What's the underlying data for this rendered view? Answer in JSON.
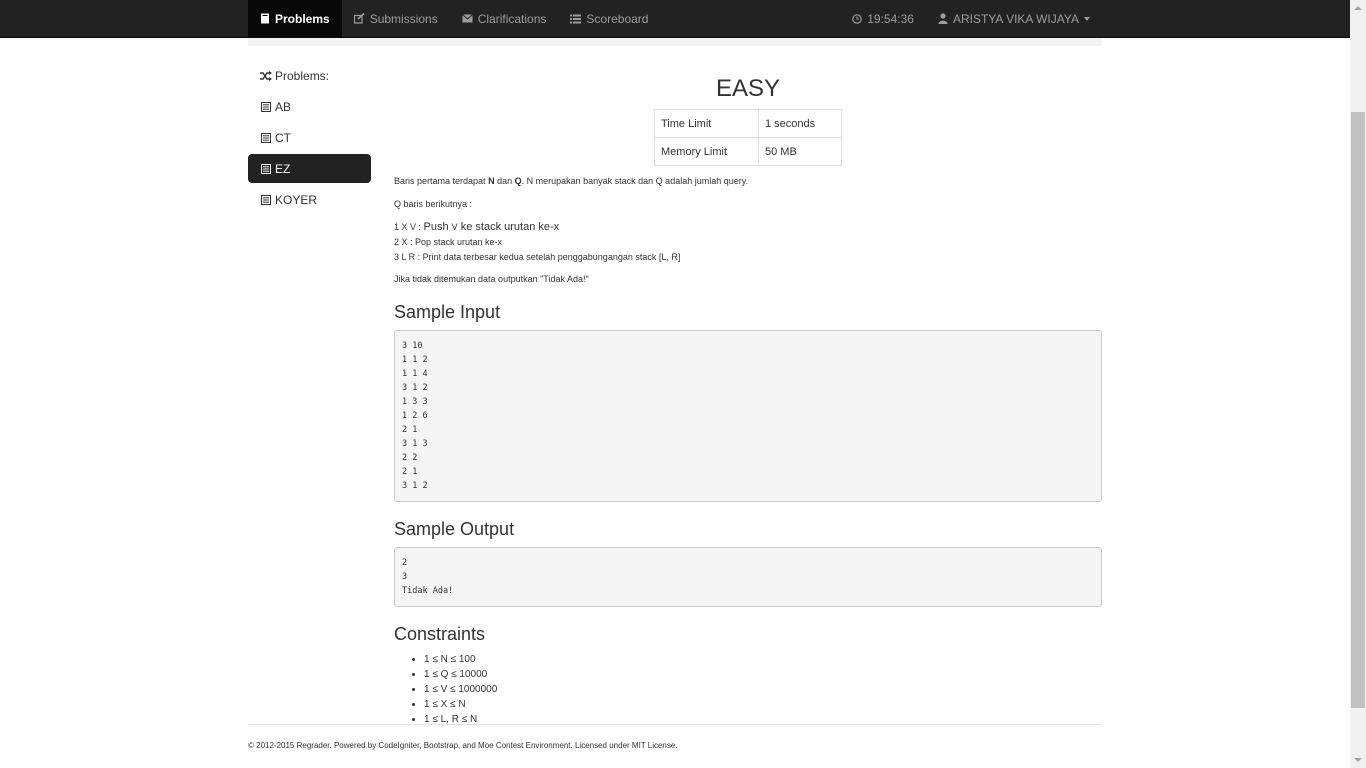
{
  "navbar": {
    "items": [
      {
        "label": "Problems",
        "icon": "book-icon",
        "active": true
      },
      {
        "label": "Submissions",
        "icon": "edit-icon",
        "active": false
      },
      {
        "label": "Clarifications",
        "icon": "envelope-icon",
        "active": false
      },
      {
        "label": "Scoreboard",
        "icon": "list-icon",
        "active": false
      }
    ],
    "clock": "19:54:36",
    "user": "ARISTYA VIKA WIJAYA"
  },
  "sidebar": {
    "header": "Problems:",
    "items": [
      {
        "label": "AB"
      },
      {
        "label": "CT"
      },
      {
        "label": "EZ",
        "active": true
      },
      {
        "label": "KOYER"
      }
    ]
  },
  "problem": {
    "title": "EASY",
    "limits": [
      {
        "label": "Time Limit",
        "value": "1 seconds"
      },
      {
        "label": "Memory Limit",
        "value": "50 MB"
      }
    ],
    "desc1": {
      "pre": "Baris pertama terdapat ",
      "n": "N",
      "mid": " dan ",
      "q": "Q",
      "post": ". N merupakan banyak stack dan Q adalah jumlah query."
    },
    "desc2": "Q baris berikutnya :",
    "query1": {
      "a": "1 X V  : ",
      "b": "Push ",
      "c": "V",
      "d": " ke stack urutan ke-",
      "e": "x"
    },
    "query2": "2 X     : Pop stack urutan ke-x",
    "query3": "3 L R  : Print data terbesar kedua setelah penggabungangan stack [L, R]",
    "desc3": "Jika tidak ditemukan data outputkan \"Tidak Ada!\"",
    "sample_input_title": "Sample Input",
    "sample_input": "3 10\n1 1 2\n1 1 4\n3 1 2\n1 3 3\n1 2 6\n2 1\n3 1 3\n2 2\n2 1\n3 1 2",
    "sample_output_title": "Sample Output",
    "sample_output": "2\n3\nTidak Ada!",
    "constraints_title": "Constraints",
    "constraints": [
      "1 ≤ N ≤ 100",
      "1 ≤ Q ≤ 10000",
      "1 ≤ V ≤ 1000000",
      "1 ≤ X ≤ N",
      "1 ≤ L, R ≤ N"
    ]
  },
  "footer": "© 2012-2015 Regrader. Powered by CodeIgniter, Bootstrap, and Moe Contest Environment. Licensed under MIT License."
}
